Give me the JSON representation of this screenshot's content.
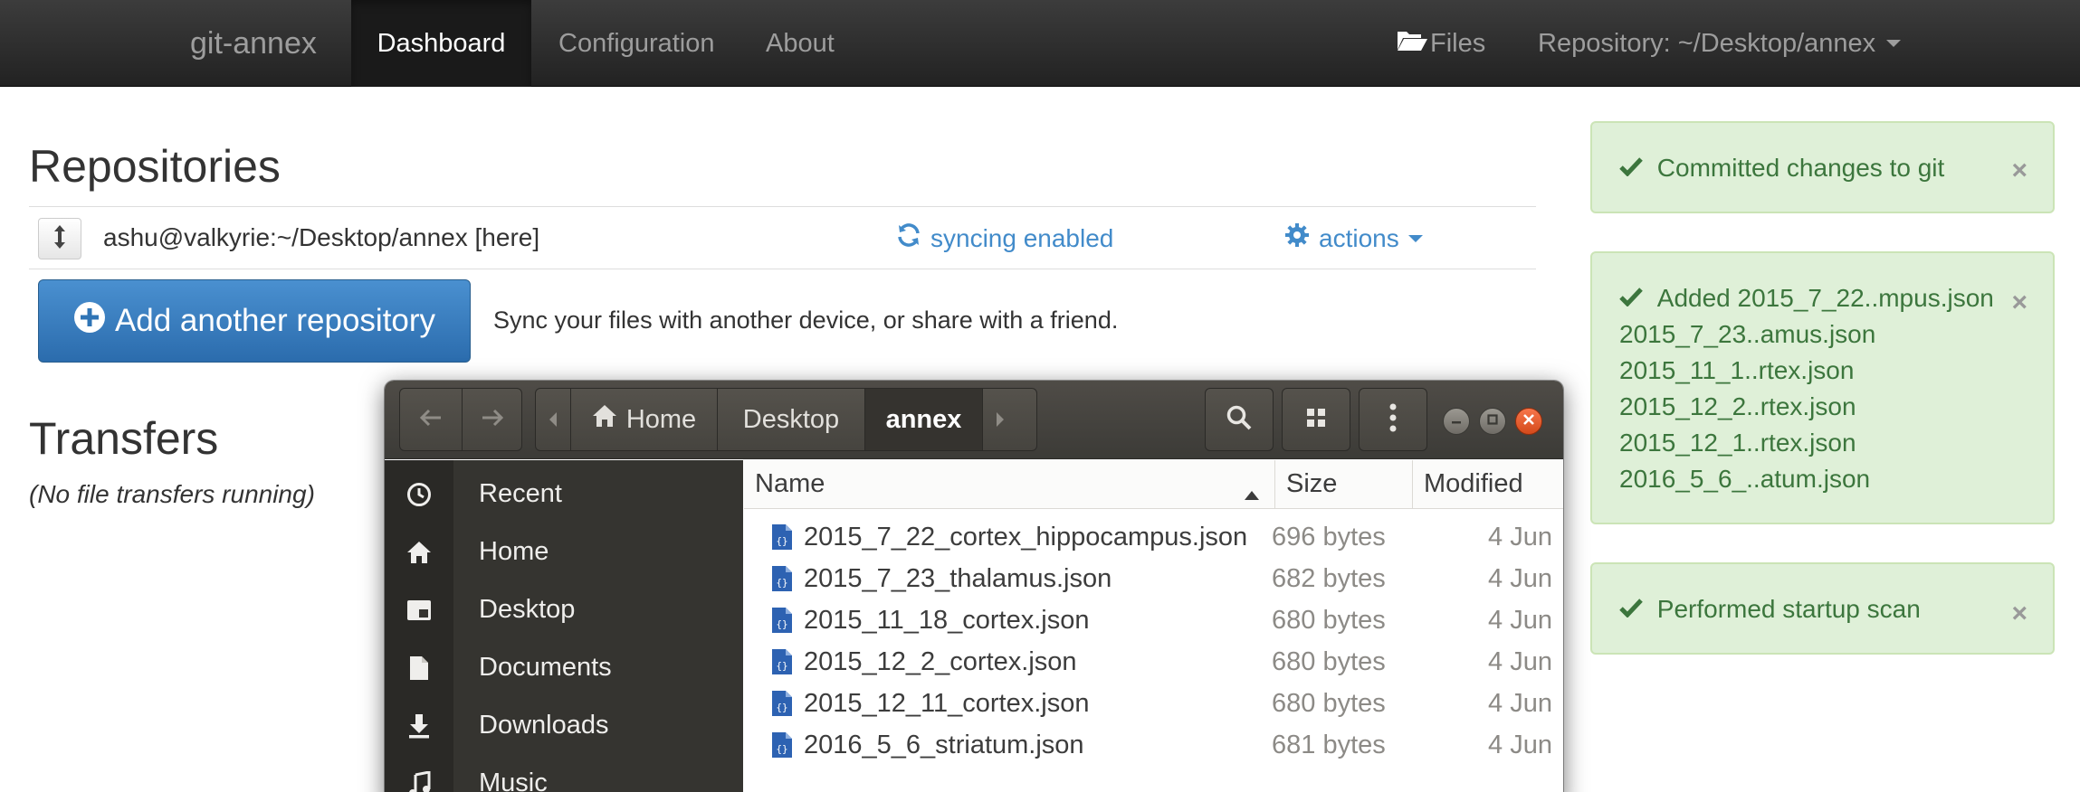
{
  "navbar": {
    "brand": "git-annex",
    "tabs": [
      {
        "label": "Dashboard",
        "active": true
      },
      {
        "label": "Configuration",
        "active": false
      },
      {
        "label": "About",
        "active": false
      }
    ],
    "files_label": "Files",
    "repository_label": "Repository: ~/Desktop/annex",
    "files_icon": "folder-open-icon"
  },
  "repositories": {
    "heading": "Repositories",
    "items": [
      {
        "name": "ashu@valkyrie:~/Desktop/annex [here]",
        "status": "syncing enabled",
        "actions_label": "actions"
      }
    ],
    "add_button_label": "Add another repository",
    "add_hint": "Sync your files with another device, or share with a friend."
  },
  "transfers": {
    "heading": "Transfers",
    "empty_text": "(No file transfers running)"
  },
  "alerts": [
    {
      "lines": [
        "Committed changes to git"
      ]
    },
    {
      "lines": [
        "Added 2015_7_22..mpus.json",
        "2015_7_23..amus.json",
        "2015_11_1..rtex.json",
        "2015_12_2..rtex.json",
        "2015_12_1..rtex.json",
        "2016_5_6_..atum.json"
      ]
    },
    {
      "lines": [
        "Performed startup scan"
      ]
    }
  ],
  "alert_close_label": "×",
  "colors": {
    "navbar": "#222222",
    "link": "#428bca",
    "primary_button": "#3071a9",
    "alert_bg": "#dff0d8",
    "alert_text": "#3c763d",
    "fm_header": "#3c3b37",
    "fm_sidebar": "#353430",
    "fm_close": "#e5541f"
  },
  "file_manager": {
    "breadcrumbs": [
      {
        "label": "Home",
        "active": false
      },
      {
        "label": "Desktop",
        "active": false
      },
      {
        "label": "annex",
        "active": true
      }
    ],
    "sidebar": [
      {
        "label": "Recent",
        "icon": "clock-icon"
      },
      {
        "label": "Home",
        "icon": "home-icon"
      },
      {
        "label": "Desktop",
        "icon": "desktop-icon"
      },
      {
        "label": "Documents",
        "icon": "document-icon"
      },
      {
        "label": "Downloads",
        "icon": "download-icon"
      },
      {
        "label": "Music",
        "icon": "music-icon"
      }
    ],
    "columns": {
      "name": "Name",
      "size": "Size",
      "modified": "Modified"
    },
    "sort": {
      "column": "Name",
      "direction": "ascending"
    },
    "files": [
      {
        "name": "2015_7_22_cortex_hippocampus.json",
        "size": "696 bytes",
        "modified": "4 Jun"
      },
      {
        "name": "2015_7_23_thalamus.json",
        "size": "682 bytes",
        "modified": "4 Jun"
      },
      {
        "name": "2015_11_18_cortex.json",
        "size": "680 bytes",
        "modified": "4 Jun"
      },
      {
        "name": "2015_12_2_cortex.json",
        "size": "680 bytes",
        "modified": "4 Jun"
      },
      {
        "name": "2015_12_11_cortex.json",
        "size": "680 bytes",
        "modified": "4 Jun"
      },
      {
        "name": "2016_5_6_striatum.json",
        "size": "681 bytes",
        "modified": "4 Jun"
      }
    ]
  }
}
